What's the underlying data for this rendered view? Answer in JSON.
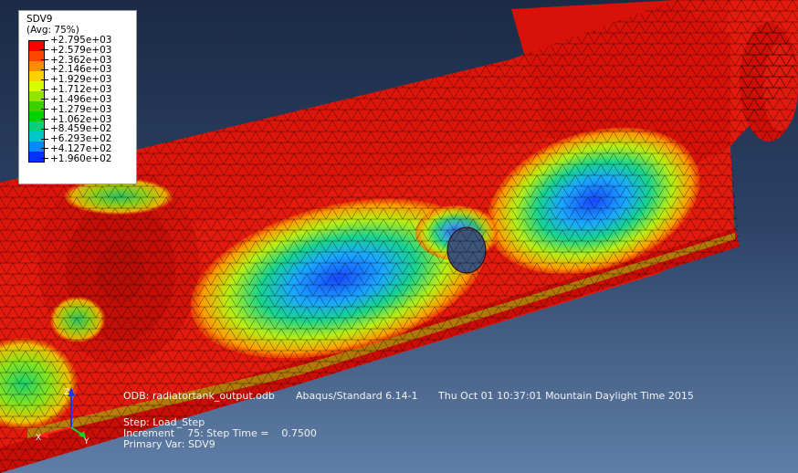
{
  "legend": {
    "variable": "SDV9",
    "averaging": "(Avg: 75%)",
    "values": [
      "+2.795e+03",
      "+2.579e+03",
      "+2.362e+03",
      "+2.146e+03",
      "+1.929e+03",
      "+1.712e+03",
      "+1.496e+03",
      "+1.279e+03",
      "+1.062e+03",
      "+8.459e+02",
      "+6.293e+02",
      "+4.127e+02",
      "+1.960e+02"
    ],
    "colors": [
      "#ff0000",
      "#ff4500",
      "#ff8c00",
      "#ffd000",
      "#d8ff00",
      "#94e400",
      "#3ad100",
      "#00d200",
      "#00d27a",
      "#00c8c8",
      "#0088ff",
      "#0033ff",
      "#0000e0"
    ]
  },
  "info": {
    "odb_label": "ODB: radiatortank_output.odb",
    "solver": "Abaqus/Standard 6.14-1",
    "timestamp": "Thu Oct 01 10:37:01 Mountain Daylight Time 2015",
    "step_line": "Step: Load_Step",
    "increment_line": "Increment    75: Step Time =    0.7500",
    "primary_var_line": "Primary Var: SDV9"
  },
  "triad": {
    "x": "X",
    "y": "Y",
    "z": "Z"
  }
}
